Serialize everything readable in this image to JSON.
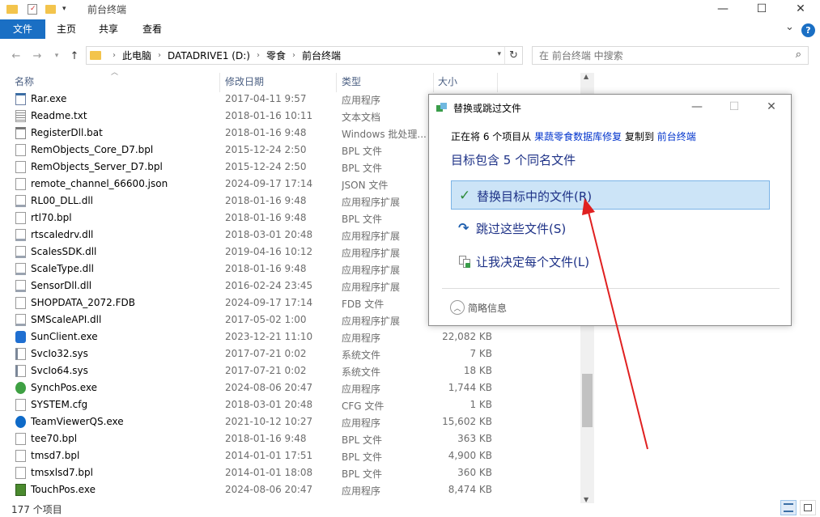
{
  "window": {
    "title": "前台终端",
    "controls": {
      "minimize": "—",
      "maximize": "☐",
      "close": "✕"
    }
  },
  "ribbon": {
    "tabs": [
      "文件",
      "主页",
      "共享",
      "查看"
    ],
    "expand": "⌄",
    "help": "?"
  },
  "address": {
    "crumbs": [
      "此电脑",
      "DATADRIVE1 (D:)",
      "零食",
      "前台终端"
    ],
    "search_placeholder": "在 前台终端 中搜索"
  },
  "columns": {
    "name": "名称",
    "date": "修改日期",
    "type": "类型",
    "size": "大小"
  },
  "files": [
    {
      "name": "Rar.exe",
      "date": "2017-04-11 9:57",
      "type": "应用程序",
      "size": "",
      "icon": "exe-icon"
    },
    {
      "name": "Readme.txt",
      "date": "2018-01-16 10:11",
      "type": "文本文档",
      "size": "",
      "icon": "text-file-icon"
    },
    {
      "name": "RegisterDll.bat",
      "date": "2018-01-16 9:48",
      "type": "Windows 批处理...",
      "size": "",
      "icon": "batch-file-icon"
    },
    {
      "name": "RemObjects_Core_D7.bpl",
      "date": "2015-12-24 2:50",
      "type": "BPL 文件",
      "size": "",
      "icon": "file-icon"
    },
    {
      "name": "RemObjects_Server_D7.bpl",
      "date": "2015-12-24 2:50",
      "type": "BPL 文件",
      "size": "",
      "icon": "file-icon"
    },
    {
      "name": "remote_channel_66600.json",
      "date": "2024-09-17 17:14",
      "type": "JSON 文件",
      "size": "",
      "icon": "file-icon"
    },
    {
      "name": "RL00_DLL.dll",
      "date": "2018-01-16 9:48",
      "type": "应用程序扩展",
      "size": "",
      "icon": "dll-icon"
    },
    {
      "name": "rtl70.bpl",
      "date": "2018-01-16 9:48",
      "type": "BPL 文件",
      "size": "",
      "icon": "file-icon"
    },
    {
      "name": "rtscaledrv.dll",
      "date": "2018-03-01 20:48",
      "type": "应用程序扩展",
      "size": "",
      "icon": "dll-icon"
    },
    {
      "name": "ScalesSDK.dll",
      "date": "2019-04-16 10:12",
      "type": "应用程序扩展",
      "size": "",
      "icon": "dll-icon"
    },
    {
      "name": "ScaleType.dll",
      "date": "2018-01-16 9:48",
      "type": "应用程序扩展",
      "size": "",
      "icon": "dll-icon"
    },
    {
      "name": "SensorDll.dll",
      "date": "2016-02-24 23:45",
      "type": "应用程序扩展",
      "size": "",
      "icon": "dll-icon"
    },
    {
      "name": "SHOPDATA_2072.FDB",
      "date": "2024-09-17 17:14",
      "type": "FDB 文件",
      "size": "",
      "icon": "file-icon"
    },
    {
      "name": "SMScaleAPI.dll",
      "date": "2017-05-02 1:00",
      "type": "应用程序扩展",
      "size": "",
      "icon": "dll-icon"
    },
    {
      "name": "SunClient.exe",
      "date": "2023-12-21 11:10",
      "type": "应用程序",
      "size": "22,082 KB",
      "icon": "sunclient-icon"
    },
    {
      "name": "SvcIo32.sys",
      "date": "2017-07-21 0:02",
      "type": "系统文件",
      "size": "7 KB",
      "icon": "sys-file-icon"
    },
    {
      "name": "SvcIo64.sys",
      "date": "2017-07-21 0:02",
      "type": "系统文件",
      "size": "18 KB",
      "icon": "sys-file-icon"
    },
    {
      "name": "SynchPos.exe",
      "date": "2024-08-06 20:47",
      "type": "应用程序",
      "size": "1,744 KB",
      "icon": "sync-icon"
    },
    {
      "name": "SYSTEM.cfg",
      "date": "2018-03-01 20:48",
      "type": "CFG 文件",
      "size": "1 KB",
      "icon": "file-icon"
    },
    {
      "name": "TeamViewerQS.exe",
      "date": "2021-10-12 10:27",
      "type": "应用程序",
      "size": "15,602 KB",
      "icon": "teamviewer-icon"
    },
    {
      "name": "tee70.bpl",
      "date": "2018-01-16 9:48",
      "type": "BPL 文件",
      "size": "363 KB",
      "icon": "file-icon"
    },
    {
      "name": "tmsd7.bpl",
      "date": "2014-01-01 17:51",
      "type": "BPL 文件",
      "size": "4,900 KB",
      "icon": "file-icon"
    },
    {
      "name": "tmsxlsd7.bpl",
      "date": "2014-01-01 18:08",
      "type": "BPL 文件",
      "size": "360 KB",
      "icon": "file-icon"
    },
    {
      "name": "TouchPos.exe",
      "date": "2024-08-06 20:47",
      "type": "应用程序",
      "size": "8,474 KB",
      "icon": "touchpos-icon"
    }
  ],
  "status": {
    "count": "177 个项目"
  },
  "dialog": {
    "title": "替换或跳过文件",
    "line_prefix": "正在将 6 个项目从",
    "source": "果蔬零食数据库修复",
    "line_mid": "复制到",
    "dest": "前台终端",
    "heading": "目标包含 5 个同名文件",
    "options": [
      {
        "label": "替换目标中的文件(R)",
        "icon": "checkmark-icon"
      },
      {
        "label": "跳过这些文件(S)",
        "icon": "skip-arrow-icon"
      },
      {
        "label": "让我决定每个文件(L)",
        "icon": "decide-files-icon"
      }
    ],
    "more": "简略信息"
  },
  "colors": {
    "accent": "#1a6fc4",
    "link": "#0033cc",
    "option_text": "#1e3287",
    "selection": "#cce4f7",
    "annotation_arrow": "#e02020"
  }
}
